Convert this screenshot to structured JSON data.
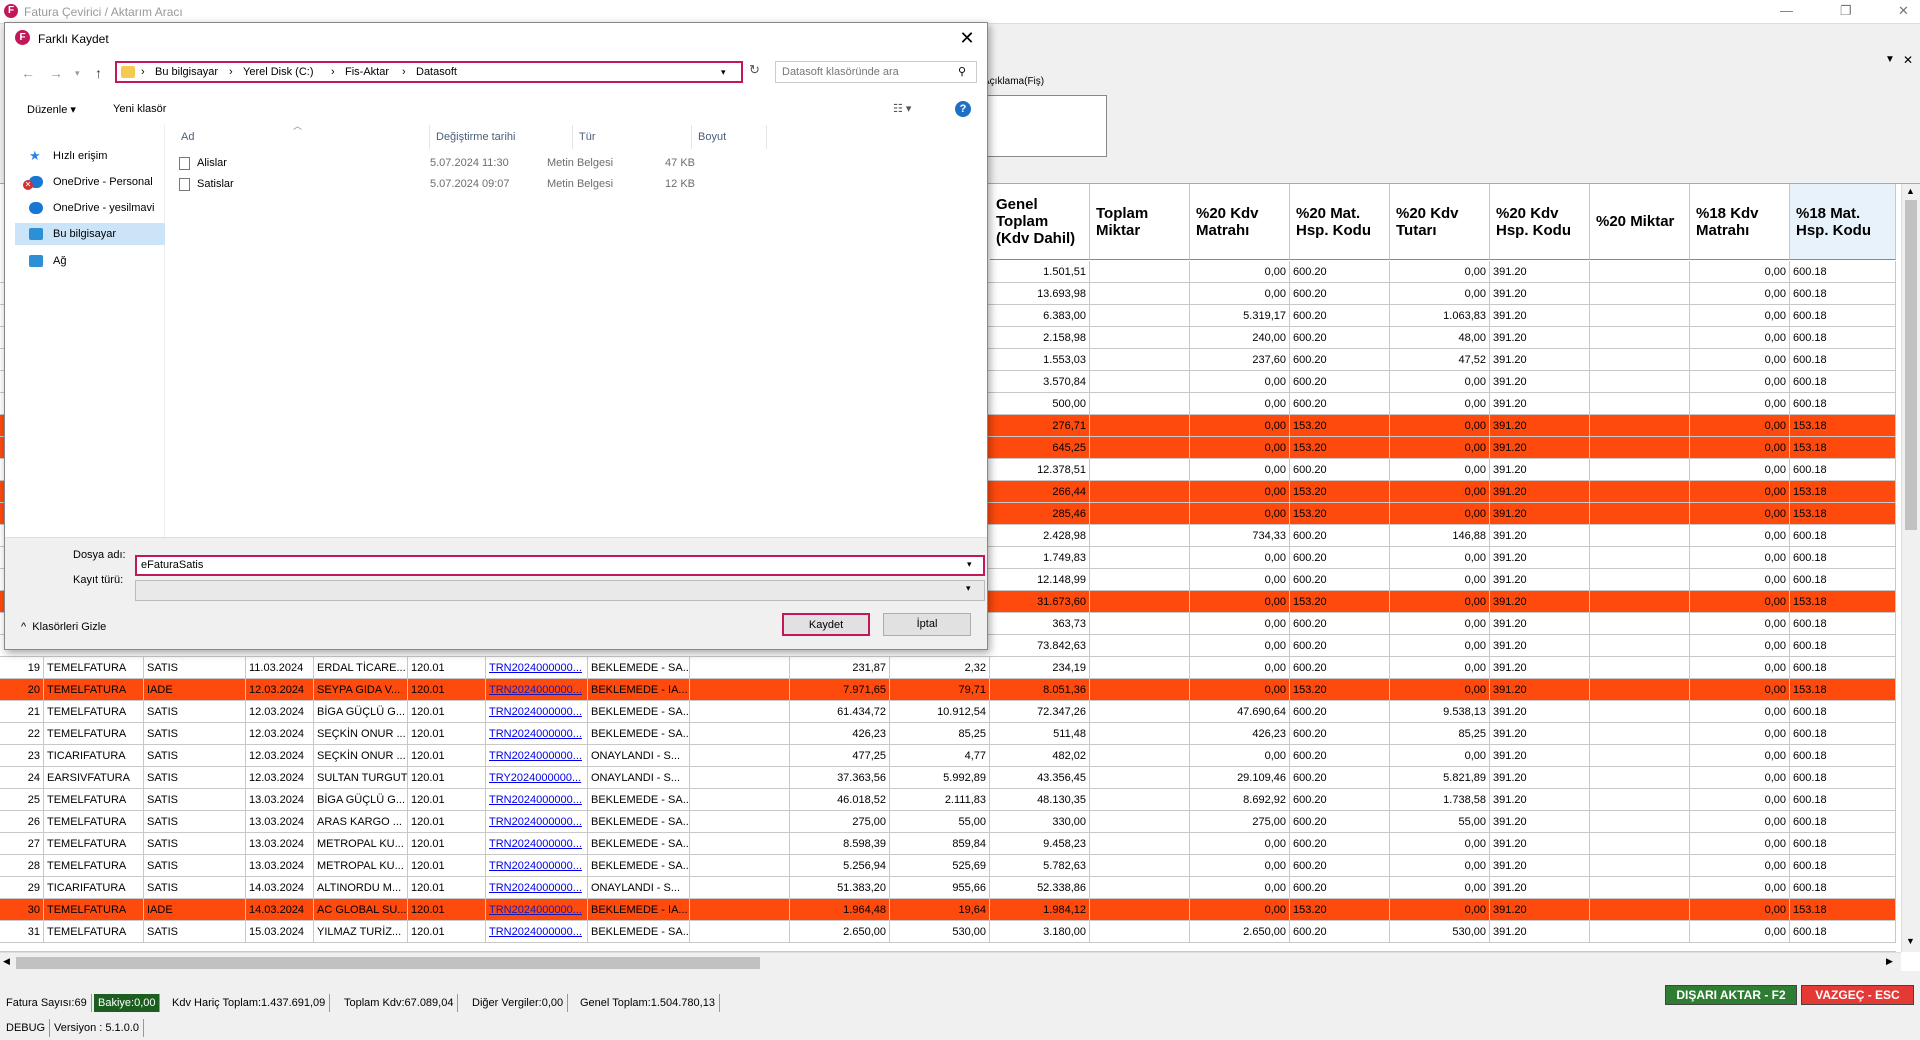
{
  "app": {
    "title": "Fatura Çevirici / Aktarım Aracı",
    "icon_letter": "F"
  },
  "main": {
    "aciklama_label": "Açıklama(Fiş)",
    "grid_headers": [
      "Genel Toplam (Kdv Dahil)",
      "Toplam Miktar",
      "%20 Kdv Matrahı",
      "%20 Mat. Hsp. Kodu",
      "%20 Kdv Tutarı",
      "%20 Kdv Hsp. Kodu",
      "%20 Miktar",
      "%18 Kdv Matrahı",
      "%18 Mat. Hsp. Kodu"
    ],
    "visible_upper_rows": [
      {
        "red": false,
        "genel": "1.501,51",
        "m20": "0,00",
        "h20": "600.20",
        "t20": "0,00",
        "k20": "391.20",
        "m18": "0,00",
        "h18": "600.18"
      },
      {
        "red": false,
        "genel": "13.693,98",
        "m20": "0,00",
        "h20": "600.20",
        "t20": "0,00",
        "k20": "391.20",
        "m18": "0,00",
        "h18": "600.18"
      },
      {
        "red": false,
        "genel": "6.383,00",
        "m20": "5.319,17",
        "h20": "600.20",
        "t20": "1.063,83",
        "k20": "391.20",
        "m18": "0,00",
        "h18": "600.18"
      },
      {
        "red": false,
        "genel": "2.158,98",
        "m20": "240,00",
        "h20": "600.20",
        "t20": "48,00",
        "k20": "391.20",
        "m18": "0,00",
        "h18": "600.18"
      },
      {
        "red": false,
        "genel": "1.553,03",
        "m20": "237,60",
        "h20": "600.20",
        "t20": "47,52",
        "k20": "391.20",
        "m18": "0,00",
        "h18": "600.18"
      },
      {
        "red": false,
        "genel": "3.570,84",
        "m20": "0,00",
        "h20": "600.20",
        "t20": "0,00",
        "k20": "391.20",
        "m18": "0,00",
        "h18": "600.18"
      },
      {
        "red": false,
        "genel": "500,00",
        "m20": "0,00",
        "h20": "600.20",
        "t20": "0,00",
        "k20": "391.20",
        "m18": "0,00",
        "h18": "600.18"
      },
      {
        "red": true,
        "genel": "276,71",
        "m20": "0,00",
        "h20": "153.20",
        "t20": "0,00",
        "k20": "391.20",
        "m18": "0,00",
        "h18": "153.18"
      },
      {
        "red": true,
        "genel": "645,25",
        "m20": "0,00",
        "h20": "153.20",
        "t20": "0,00",
        "k20": "391.20",
        "m18": "0,00",
        "h18": "153.18"
      },
      {
        "red": false,
        "genel": "12.378,51",
        "m20": "0,00",
        "h20": "600.20",
        "t20": "0,00",
        "k20": "391.20",
        "m18": "0,00",
        "h18": "600.18"
      },
      {
        "red": true,
        "genel": "266,44",
        "m20": "0,00",
        "h20": "153.20",
        "t20": "0,00",
        "k20": "391.20",
        "m18": "0,00",
        "h18": "153.18"
      },
      {
        "red": true,
        "genel": "285,46",
        "m20": "0,00",
        "h20": "153.20",
        "t20": "0,00",
        "k20": "391.20",
        "m18": "0,00",
        "h18": "153.18"
      },
      {
        "red": false,
        "genel": "2.428,98",
        "m20": "734,33",
        "h20": "600.20",
        "t20": "146,88",
        "k20": "391.20",
        "m18": "0,00",
        "h18": "600.18"
      },
      {
        "red": false,
        "genel": "1.749,83",
        "m20": "0,00",
        "h20": "600.20",
        "t20": "0,00",
        "k20": "391.20",
        "m18": "0,00",
        "h18": "600.18"
      },
      {
        "red": false,
        "genel": "12.148,99",
        "m20": "0,00",
        "h20": "600.20",
        "t20": "0,00",
        "k20": "391.20",
        "m18": "0,00",
        "h18": "600.18"
      },
      {
        "red": true,
        "genel": "31.673,60",
        "m20": "0,00",
        "h20": "153.20",
        "t20": "0,00",
        "k20": "391.20",
        "m18": "0,00",
        "h18": "153.18"
      },
      {
        "red": false,
        "genel": "363,73",
        "m20": "0,00",
        "h20": "600.20",
        "t20": "0,00",
        "k20": "391.20",
        "m18": "0,00",
        "h18": "600.18"
      },
      {
        "red": false,
        "genel": "73.842,63",
        "m20": "0,00",
        "h20": "600.20",
        "t20": "0,00",
        "k20": "391.20",
        "m18": "0,00",
        "h18": "600.18"
      }
    ],
    "full_rows": [
      {
        "no": "19",
        "red": false,
        "tip": "TEMELFATURA",
        "tur": "SATIS",
        "tarih": "11.03.2024",
        "cari": "ERDAL TİCARE...",
        "hsp": "120.01",
        "fno": "TRN2024000000...",
        "durum": "BEKLEMEDE - SA...",
        "kdvharic": "231,87",
        "kdv": "2,32",
        "genel": "234,19",
        "m20": "0,00",
        "h20": "600.20",
        "t20": "0,00",
        "k20": "391.20",
        "m18": "0,00",
        "h18": "600.18"
      },
      {
        "no": "20",
        "red": true,
        "tip": "TEMELFATURA",
        "tur": "IADE",
        "tarih": "12.03.2024",
        "cari": "SEYPA GIDA V...",
        "hsp": "120.01",
        "fno": "TRN2024000000...",
        "durum": "BEKLEMEDE - IA...",
        "kdvharic": "7.971,65",
        "kdv": "79,71",
        "genel": "8.051,36",
        "m20": "0,00",
        "h20": "153.20",
        "t20": "0,00",
        "k20": "391.20",
        "m18": "0,00",
        "h18": "153.18"
      },
      {
        "no": "21",
        "red": false,
        "tip": "TEMELFATURA",
        "tur": "SATIS",
        "tarih": "12.03.2024",
        "cari": "BİGA GÜÇLÜ G...",
        "hsp": "120.01",
        "fno": "TRN2024000000...",
        "durum": "BEKLEMEDE - SA...",
        "kdvharic": "61.434,72",
        "kdv": "10.912,54",
        "genel": "72.347,26",
        "m20": "47.690,64",
        "h20": "600.20",
        "t20": "9.538,13",
        "k20": "391.20",
        "m18": "0,00",
        "h18": "600.18"
      },
      {
        "no": "22",
        "red": false,
        "tip": "TEMELFATURA",
        "tur": "SATIS",
        "tarih": "12.03.2024",
        "cari": "SEÇKİN ONUR ...",
        "hsp": "120.01",
        "fno": "TRN2024000000...",
        "durum": "BEKLEMEDE - SA...",
        "kdvharic": "426,23",
        "kdv": "85,25",
        "genel": "511,48",
        "m20": "426,23",
        "h20": "600.20",
        "t20": "85,25",
        "k20": "391.20",
        "m18": "0,00",
        "h18": "600.18"
      },
      {
        "no": "23",
        "red": false,
        "tip": "TICARIFATURA",
        "tur": "SATIS",
        "tarih": "12.03.2024",
        "cari": "SEÇKİN ONUR ...",
        "hsp": "120.01",
        "fno": "TRN2024000000...",
        "durum": "ONAYLANDI - S...",
        "kdvharic": "477,25",
        "kdv": "4,77",
        "genel": "482,02",
        "m20": "0,00",
        "h20": "600.20",
        "t20": "0,00",
        "k20": "391.20",
        "m18": "0,00",
        "h18": "600.18"
      },
      {
        "no": "24",
        "red": false,
        "tip": "EARSIVFATURA",
        "tur": "SATIS",
        "tarih": "12.03.2024",
        "cari": "SULTAN TURGUT",
        "hsp": "120.01",
        "fno": "TRY2024000000...",
        "durum": "ONAYLANDI - S...",
        "kdvharic": "37.363,56",
        "kdv": "5.992,89",
        "genel": "43.356,45",
        "m20": "29.109,46",
        "h20": "600.20",
        "t20": "5.821,89",
        "k20": "391.20",
        "m18": "0,00",
        "h18": "600.18"
      },
      {
        "no": "25",
        "red": false,
        "tip": "TEMELFATURA",
        "tur": "SATIS",
        "tarih": "13.03.2024",
        "cari": "BİGA GÜÇLÜ G...",
        "hsp": "120.01",
        "fno": "TRN2024000000...",
        "durum": "BEKLEMEDE - SA...",
        "kdvharic": "46.018,52",
        "kdv": "2.111,83",
        "genel": "48.130,35",
        "m20": "8.692,92",
        "h20": "600.20",
        "t20": "1.738,58",
        "k20": "391.20",
        "m18": "0,00",
        "h18": "600.18"
      },
      {
        "no": "26",
        "red": false,
        "tip": "TEMELFATURA",
        "tur": "SATIS",
        "tarih": "13.03.2024",
        "cari": "ARAS KARGO ...",
        "hsp": "120.01",
        "fno": "TRN2024000000...",
        "durum": "BEKLEMEDE - SA...",
        "kdvharic": "275,00",
        "kdv": "55,00",
        "genel": "330,00",
        "m20": "275,00",
        "h20": "600.20",
        "t20": "55,00",
        "k20": "391.20",
        "m18": "0,00",
        "h18": "600.18"
      },
      {
        "no": "27",
        "red": false,
        "tip": "TEMELFATURA",
        "tur": "SATIS",
        "tarih": "13.03.2024",
        "cari": "METROPAL KU...",
        "hsp": "120.01",
        "fno": "TRN2024000000...",
        "durum": "BEKLEMEDE - SA...",
        "kdvharic": "8.598,39",
        "kdv": "859,84",
        "genel": "9.458,23",
        "m20": "0,00",
        "h20": "600.20",
        "t20": "0,00",
        "k20": "391.20",
        "m18": "0,00",
        "h18": "600.18"
      },
      {
        "no": "28",
        "red": false,
        "tip": "TEMELFATURA",
        "tur": "SATIS",
        "tarih": "13.03.2024",
        "cari": "METROPAL KU...",
        "hsp": "120.01",
        "fno": "TRN2024000000...",
        "durum": "BEKLEMEDE - SA...",
        "kdvharic": "5.256,94",
        "kdv": "525,69",
        "genel": "5.782,63",
        "m20": "0,00",
        "h20": "600.20",
        "t20": "0,00",
        "k20": "391.20",
        "m18": "0,00",
        "h18": "600.18"
      },
      {
        "no": "29",
        "red": false,
        "tip": "TICARIFATURA",
        "tur": "SATIS",
        "tarih": "14.03.2024",
        "cari": "ALTINORDU M...",
        "hsp": "120.01",
        "fno": "TRN2024000000...",
        "durum": "ONAYLANDI - S...",
        "kdvharic": "51.383,20",
        "kdv": "955,66",
        "genel": "52.338,86",
        "m20": "0,00",
        "h20": "600.20",
        "t20": "0,00",
        "k20": "391.20",
        "m18": "0,00",
        "h18": "600.18"
      },
      {
        "no": "30",
        "red": true,
        "tip": "TEMELFATURA",
        "tur": "IADE",
        "tarih": "14.03.2024",
        "cari": "AC GLOBAL SU...",
        "hsp": "120.01",
        "fno": "TRN2024000000...",
        "durum": "BEKLEMEDE - IA...",
        "kdvharic": "1.964,48",
        "kdv": "19,64",
        "genel": "1.984,12",
        "m20": "0,00",
        "h20": "153.20",
        "t20": "0,00",
        "k20": "391.20",
        "m18": "0,00",
        "h18": "153.18"
      },
      {
        "no": "31",
        "red": false,
        "tip": "TEMELFATURA",
        "tur": "SATIS",
        "tarih": "15.03.2024",
        "cari": "YILMAZ TURİZ...",
        "hsp": "120.01",
        "fno": "TRN2024000000...",
        "durum": "BEKLEMEDE - SA...",
        "kdvharic": "2.650,00",
        "kdv": "530,00",
        "genel": "3.180,00",
        "m20": "2.650,00",
        "h20": "600.20",
        "t20": "530,00",
        "k20": "391.20",
        "m18": "0,00",
        "h18": "600.18"
      }
    ],
    "red_color": "#ff4a0e"
  },
  "status": {
    "fatura_sayisi": "Fatura Sayısı:69",
    "bakiye": "Bakiye:0,00",
    "kdv_haric": "Kdv Hariç Toplam:1.437.691,09",
    "toplam_kdv": "Toplam Kdv:67.089,04",
    "diger": "Diğer Vergiler:0,00",
    "genel": "Genel Toplam:1.504.780,13",
    "debug": "DEBUG",
    "versiyon": "Versiyon : 5.1.0.0",
    "export_button": "DIŞARI AKTAR - F2",
    "cancel_button": "VAZGEÇ - ESC"
  },
  "dialog": {
    "title": "Farklı Kaydet",
    "breadcrumbs": [
      "Bu bilgisayar",
      "Yerel Disk (C:)",
      "Fis-Aktar",
      "Datasoft"
    ],
    "search_placeholder": "Datasoft klasöründe ara",
    "organize": "Düzenle",
    "new_folder": "Yeni klasör",
    "nav_items": [
      {
        "label": "Hızlı erişim",
        "icon": "star-icon"
      },
      {
        "label": "OneDrive - Personal",
        "icon": "cloud-error-icon"
      },
      {
        "label": "OneDrive - yesilmavi",
        "icon": "cloud-icon"
      },
      {
        "label": "Bu bilgisayar",
        "icon": "computer-icon"
      },
      {
        "label": "Ağ",
        "icon": "network-icon"
      }
    ],
    "columns": [
      "Ad",
      "Değiştirme tarihi",
      "Tür",
      "Boyut"
    ],
    "files": [
      {
        "name": "Alislar",
        "date": "5.07.2024 11:30",
        "type": "Metin Belgesi",
        "size": "47 KB"
      },
      {
        "name": "Satislar",
        "date": "5.07.2024 09:07",
        "type": "Metin Belgesi",
        "size": "12 KB"
      }
    ],
    "filename_label": "Dosya adı:",
    "filename_value": "eFaturaSatis",
    "filetype_label": "Kayıt türü:",
    "filetype_value": "",
    "hide_folders": "Klasörleri Gizle",
    "save": "Kaydet",
    "cancel": "İptal",
    "highlight_color": "#c2185b"
  }
}
